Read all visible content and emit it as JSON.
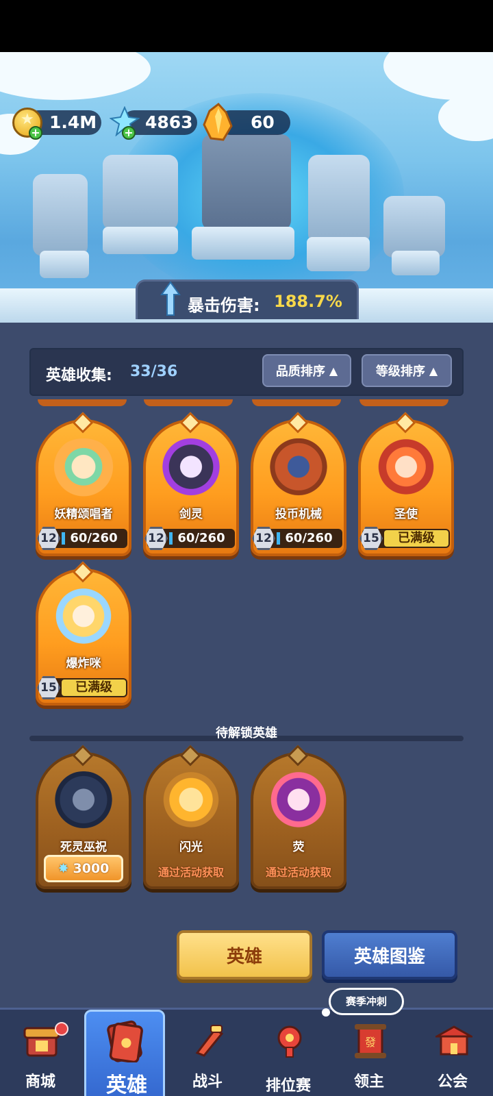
{
  "currency": {
    "gold": "1.4M",
    "crystal": "4863",
    "amber": "60"
  },
  "crit": {
    "label": "暴击伤害:",
    "value": "188.7%"
  },
  "collection": {
    "label": "英雄收集:",
    "value": "33/36",
    "sort_quality": "品质排序",
    "sort_level": "等级排序"
  },
  "heroes": [
    {
      "name": "妖精颂唱者",
      "level": "12",
      "progress": "60/260"
    },
    {
      "name": "剑灵",
      "level": "12",
      "progress": "60/260"
    },
    {
      "name": "投币机械",
      "level": "12",
      "progress": "60/260"
    },
    {
      "name": "圣使",
      "level": "15",
      "status": "已满级"
    },
    {
      "name": "爆炸咪",
      "level": "15",
      "status": "已满级"
    }
  ],
  "locked_section": {
    "title": "待解锁英雄"
  },
  "locked_heroes": [
    {
      "name": "死灵巫祝",
      "cost": "3000"
    },
    {
      "name": "闪光",
      "unlock": "通过活动获取"
    },
    {
      "name": "荧",
      "unlock": "通过活动获取"
    }
  ],
  "buttons": {
    "heroes": "英雄",
    "codex": "英雄图鉴"
  },
  "season_bubble": "赛季冲刺",
  "nav": [
    {
      "label": "商城",
      "icon": "shop-icon"
    },
    {
      "label": "英雄",
      "icon": "hero-cards-icon"
    },
    {
      "label": "战斗",
      "icon": "battle-icon"
    },
    {
      "label": "排位赛",
      "icon": "ranked-icon"
    },
    {
      "label": "领主",
      "icon": "lord-icon"
    },
    {
      "label": "公会",
      "icon": "guild-icon"
    }
  ]
}
